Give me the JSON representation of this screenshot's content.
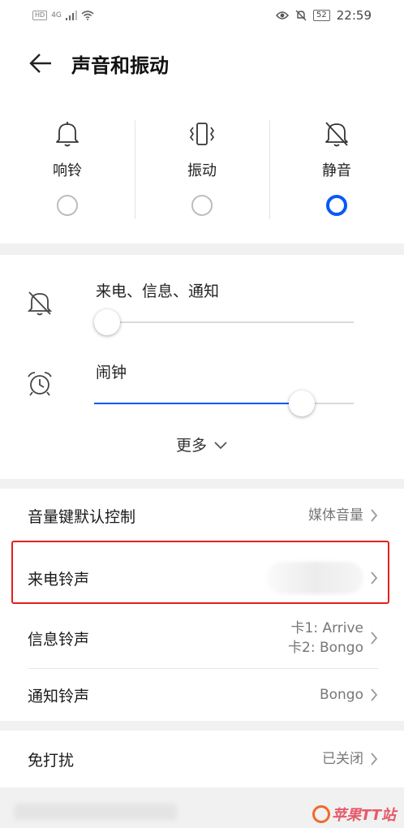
{
  "status_bar": {
    "left_hd": "HD",
    "left_net": "4G",
    "battery": "52",
    "time": "22:59"
  },
  "header": {
    "title": "声音和振动"
  },
  "modes": [
    {
      "label": "响铃",
      "icon": "bell-icon",
      "checked": false
    },
    {
      "label": "振动",
      "icon": "vibrate-icon",
      "checked": false
    },
    {
      "label": "静音",
      "icon": "bell-off-icon",
      "checked": true
    }
  ],
  "volume": {
    "ringer": {
      "label": "来电、信息、通知",
      "icon": "bell-off-icon",
      "level": 0
    },
    "alarm": {
      "label": "闹钟",
      "icon": "alarm-clock-icon",
      "level": 0.8
    },
    "more_label": "更多"
  },
  "settings": {
    "volume_key": {
      "label": "音量键默认控制",
      "value": "媒体音量"
    },
    "ringtone": {
      "label": "来电铃声",
      "value": ""
    },
    "message_tone": {
      "label": "信息铃声",
      "value_line1": "卡1: Arrive",
      "value_line2": "卡2: Bongo"
    },
    "notification_tone": {
      "label": "通知铃声",
      "value": "Bongo"
    }
  },
  "dnd": {
    "label": "免打扰",
    "value": "已关闭"
  },
  "watermark": {
    "text": "苹果TT站"
  },
  "colors": {
    "accent": "#0a59f7",
    "highlight": "#e41f1f"
  }
}
